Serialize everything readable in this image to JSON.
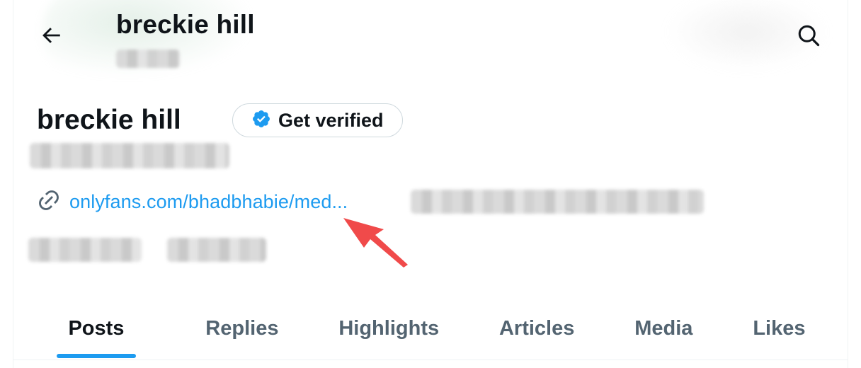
{
  "header": {
    "title": "breckie hill",
    "back_icon": "back-arrow-icon",
    "search_icon": "search-icon"
  },
  "profile": {
    "name": "breckie hill",
    "verify_button": {
      "label": "Get verified",
      "icon": "verified-badge-icon"
    },
    "link": {
      "icon": "link-icon",
      "text": "onlyfans.com/bhadbhabie/med..."
    }
  },
  "tabs": [
    {
      "label": "Posts",
      "active": true
    },
    {
      "label": "Replies",
      "active": false
    },
    {
      "label": "Highlights",
      "active": false
    },
    {
      "label": "Articles",
      "active": false
    },
    {
      "label": "Media",
      "active": false
    },
    {
      "label": "Likes",
      "active": false
    }
  ],
  "colors": {
    "accent": "#1d9bf0",
    "text_primary": "#0f1419",
    "text_secondary": "#536471",
    "annotation_arrow": "#f04a4a"
  }
}
